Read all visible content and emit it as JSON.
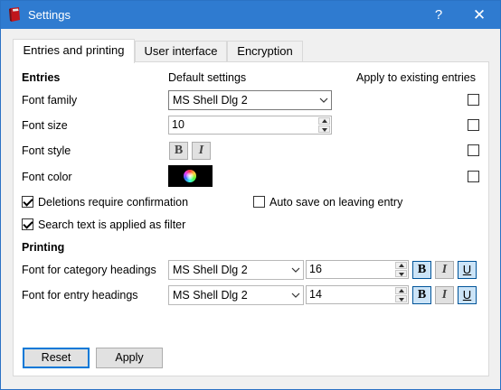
{
  "window": {
    "title": "Settings",
    "help_label": "?",
    "close_label": "✕",
    "icon": "red-book-icon"
  },
  "tabs": [
    {
      "label": "Entries and printing",
      "active": true
    },
    {
      "label": "User interface",
      "active": false
    },
    {
      "label": "Encryption",
      "active": false
    }
  ],
  "entries": {
    "heading": "Entries",
    "default_settings_label": "Default settings",
    "apply_existing_label": "Apply to existing entries",
    "font_family": {
      "label": "Font family",
      "value": "MS Shell Dlg 2",
      "apply": false
    },
    "font_size": {
      "label": "Font size",
      "value": "10",
      "apply": false
    },
    "font_style": {
      "label": "Font style",
      "bold_label": "B",
      "italic_label": "I",
      "bold_on": false,
      "italic_on": false,
      "apply": false
    },
    "font_color": {
      "label": "Font color",
      "color": "#000000",
      "apply": false
    },
    "deletions_confirm": {
      "label": "Deletions require confirmation",
      "checked": true
    },
    "auto_save": {
      "label": "Auto save on leaving entry",
      "checked": false
    },
    "search_filter": {
      "label": "Search text is applied as filter",
      "checked": true
    }
  },
  "printing": {
    "heading": "Printing",
    "category_headings": {
      "label": "Font for category headings",
      "font": "MS Shell Dlg 2",
      "size": "16",
      "bold_label": "B",
      "italic_label": "I",
      "underline_label": "U",
      "bold_on": true,
      "italic_on": false,
      "underline_on": true
    },
    "entry_headings": {
      "label": "Font for entry headings",
      "font": "MS Shell Dlg 2",
      "size": "14",
      "bold_label": "B",
      "italic_label": "I",
      "underline_label": "U",
      "bold_on": true,
      "italic_on": false,
      "underline_on": true
    }
  },
  "buttons": {
    "reset_label": "Reset",
    "apply_label": "Apply"
  },
  "colors": {
    "titlebar": "#2f7bd0",
    "accent": "#0078d7",
    "toggle_on": "#cce4f7"
  }
}
